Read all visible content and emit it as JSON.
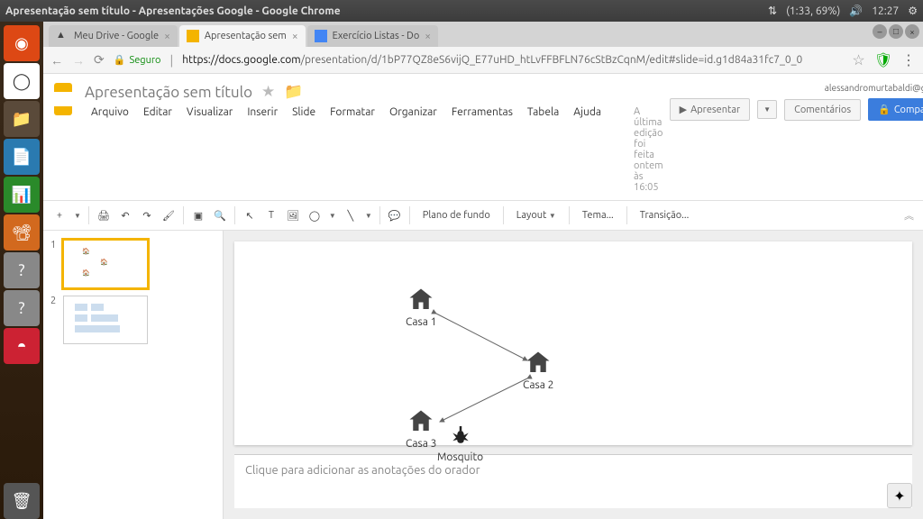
{
  "window_title": "Apresentação sem título - Apresentações Google - Google Chrome",
  "system": {
    "battery": "(1:33, 69%)",
    "time": "12:27"
  },
  "tabs": [
    {
      "label": "Meu Drive - Google"
    },
    {
      "label": "Apresentação sem"
    },
    {
      "label": "Exercício Listas - Do"
    }
  ],
  "addr": {
    "secure_label": "Seguro",
    "host": "https://docs.google.com",
    "path": "/presentation/d/1bP77QZ8eS6vijQ_E77uHD_htLvFFBFLN76cStBzCqnM/edit#slide=id.g1d84a31fc7_0_0"
  },
  "doc": {
    "title": "Apresentação sem título",
    "user_email": "alessandromurtabaldi@gmail.com",
    "last_edit": "A última edição foi feita ontem às 16:05"
  },
  "menu": [
    "Arquivo",
    "Editar",
    "Visualizar",
    "Inserir",
    "Slide",
    "Formatar",
    "Organizar",
    "Ferramentas",
    "Tabela",
    "Ajuda"
  ],
  "buttons": {
    "present": "Apresentar",
    "comments": "Comentários",
    "share": "Compartilhar"
  },
  "toolbar": {
    "bg": "Plano de fundo",
    "layout": "Layout",
    "theme": "Tema...",
    "transition": "Transição..."
  },
  "slides": {
    "s1": "1",
    "s2": "2"
  },
  "content": {
    "casa1": "Casa 1",
    "casa2": "Casa 2",
    "casa3": "Casa 3",
    "mosquito": "Mosquito"
  },
  "speaker_placeholder": "Clique para adicionar as anotações do orador"
}
